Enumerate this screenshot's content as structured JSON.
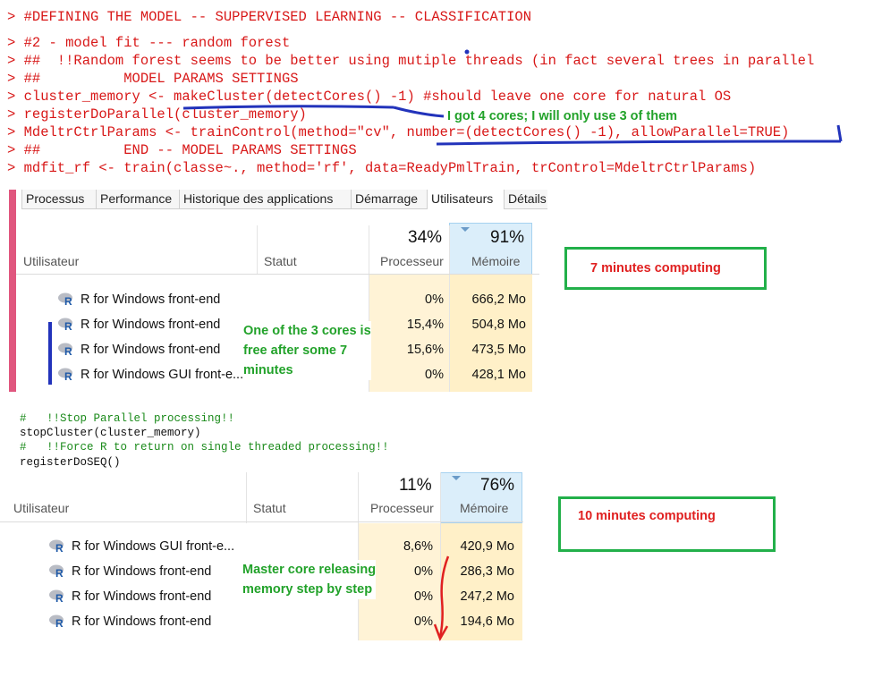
{
  "console": {
    "lines": [
      "> #DEFINING THE MODEL -- SUPPERVISED LEARNING -- CLASSIFICATION",
      "> #2 - model fit --- random forest",
      "> ##  !!Random forest seems to be better using mutiple threads (in fact several trees in parallel",
      "> ##          MODEL PARAMS SETTINGS",
      "> cluster_memory <- makeCluster(detectCores() -1) #should leave one core for natural OS",
      "> registerDoParallel(cluster_memory)",
      "> MdeltrCtrlParams <- trainControl(method=\"cv\", number=(detectCores() -1), allowParallel=TRUE)",
      "> ##          END -- MODEL PARAMS SETTINGS",
      "> mdfit_rf <- train(classe~., method='rf', data=ReadyPmlTrain, trControl=MdeltrCtrlParams)"
    ],
    "annotation": "I got 4 cores; I will only use 3 of them"
  },
  "panel1": {
    "tabs": [
      "Processus",
      "Performance",
      "Historique des applications",
      "Démarrage",
      "Utilisateurs",
      "Détails"
    ],
    "cpu_pct": "34%",
    "mem_pct": "91%",
    "col_user": "Utilisateur",
    "col_status": "Statut",
    "col_cpu": "Processeur",
    "col_mem": "Mémoire",
    "rows": [
      {
        "name": "R for Windows front-end",
        "cpu": "0%",
        "mem": "666,2 Mo"
      },
      {
        "name": "R for Windows front-end",
        "cpu": "15,4%",
        "mem": "504,8 Mo"
      },
      {
        "name": "R for Windows front-end",
        "cpu": "15,6%",
        "mem": "473,5 Mo"
      },
      {
        "name": "R for Windows GUI front-e...",
        "cpu": "0%",
        "mem": "428,1 Mo"
      }
    ],
    "annotation_l1": "One of the 3 cores is",
    "annotation_l2": "free after some 7",
    "annotation_l3": "minutes",
    "box_label": "7 minutes computing"
  },
  "code2": {
    "l1": "#   !!Stop Parallel processing!!",
    "l2": "stopCluster(cluster_memory)",
    "l3": "#   !!Force R to return on single threaded processing!!",
    "l4": "registerDoSEQ()"
  },
  "panel2": {
    "cpu_pct": "11%",
    "mem_pct": "76%",
    "col_user": "Utilisateur",
    "col_status": "Statut",
    "col_cpu": "Processeur",
    "col_mem": "Mémoire",
    "rows": [
      {
        "name": "R for Windows GUI front-e...",
        "cpu": "8,6%",
        "mem": "420,9 Mo"
      },
      {
        "name": "R for Windows front-end",
        "cpu": "0%",
        "mem": "286,3 Mo"
      },
      {
        "name": "R for Windows front-end",
        "cpu": "0%",
        "mem": "247,2 Mo"
      },
      {
        "name": "R for Windows front-end",
        "cpu": "0%",
        "mem": "194,6 Mo"
      }
    ],
    "annotation_l1": "Master core releasing",
    "annotation_l2": "memory step by step",
    "box_label": "10 minutes computing"
  }
}
